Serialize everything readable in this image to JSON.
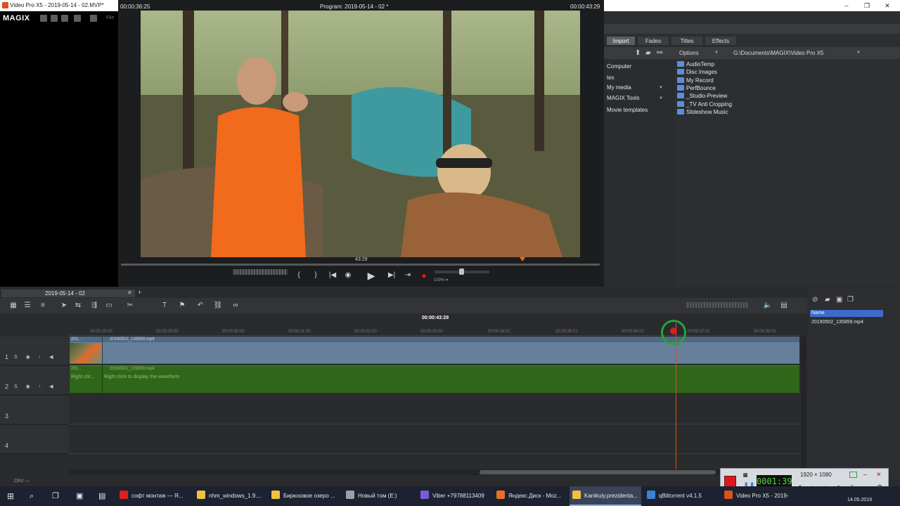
{
  "window": {
    "title": "Video Pro X5 - 2019-05-14 - 02.MVP*",
    "minimize": "–",
    "maximize": "❐",
    "close": "✕"
  },
  "app": {
    "logo": "MAGIX",
    "file_menu": "File"
  },
  "monitor": {
    "timecode_left": "00:00:36:25",
    "title": "Program: 2019-05-14 - 02 *",
    "timecode_right": "00:00:43:29",
    "scrub_label": "43:29",
    "zoom_pct": "100% ▾",
    "transport": {
      "mark_in": "{",
      "mark_out": "}",
      "prev": "|◀",
      "loop": "◉",
      "play": "▶",
      "next": "▶|",
      "end": "⇥",
      "record": "●"
    }
  },
  "media": {
    "tabs": [
      "Import",
      "Fades",
      "Titles",
      "Effects"
    ],
    "active_tab": "Import",
    "options_label": "Options",
    "path": "G:\\Documents\\MAGIX\\Video Pro X5",
    "nav": [
      "Computer",
      "tex",
      "My media",
      "MAGIX Tools",
      "Movie templates"
    ],
    "folders": [
      "AudioTemp",
      "Disc Images",
      "My Record",
      "PerfBounce",
      "_Studio-Preview",
      "_TV Anti Cropping",
      "Slideshow Music"
    ]
  },
  "timeline": {
    "tab_title": "2019-05-14 - 02",
    "timecode": "00:00:43:29",
    "ruler": [
      "00:00:28:00",
      "00:00:29:00",
      "00:00:30:00",
      "00:00:31:00",
      "00:00:32:00",
      "00:00:33:00",
      "00:00:34:01",
      "00:00:35:01",
      "00:00:36:01",
      "00:00:37:01",
      "00:00:38:01"
    ],
    "tracks": [
      "1",
      "2",
      "3",
      "4"
    ],
    "track_buttons": "S  ◉  ↑  ◀",
    "video_clip_name": "20190502_135859.mp4",
    "video_clip_short": "201...",
    "audio_clip_name": "20190502_135859.mp4",
    "audio_clip_short": "201...",
    "audio_hint": "Right click to display the waveform",
    "audio_hint_short": "Right clic...",
    "cpu_label": "CPU: —"
  },
  "pool": {
    "column_name": "Name",
    "file": "20190502_135859.mp4"
  },
  "recorder": {
    "time": "0001:39",
    "resolution": "1920 × 1080"
  },
  "taskbar": {
    "items": [
      {
        "label": "софт монтаж — Я...",
        "color": "#e02020"
      },
      {
        "label": "nhm_windows_1.9....",
        "color": "#f0c040"
      },
      {
        "label": "Бирюзовое озеро ...",
        "color": "#f0c040"
      },
      {
        "label": "Новый том (E:)",
        "color": "#9aa0a6"
      },
      {
        "label": "Viber +79788113409",
        "color": "#7b5bd6"
      },
      {
        "label": "Яндекс.Диск - Moz...",
        "color": "#e8702a"
      },
      {
        "label": "Kanikuly.prezidenta...",
        "color": "#f0c040"
      },
      {
        "label": "qBittorrent v4.1.5",
        "color": "#3b82d6"
      },
      {
        "label": "Video Pro X5 - 2019-...",
        "color": "#d9531e"
      }
    ],
    "date": "14.05.2019"
  }
}
